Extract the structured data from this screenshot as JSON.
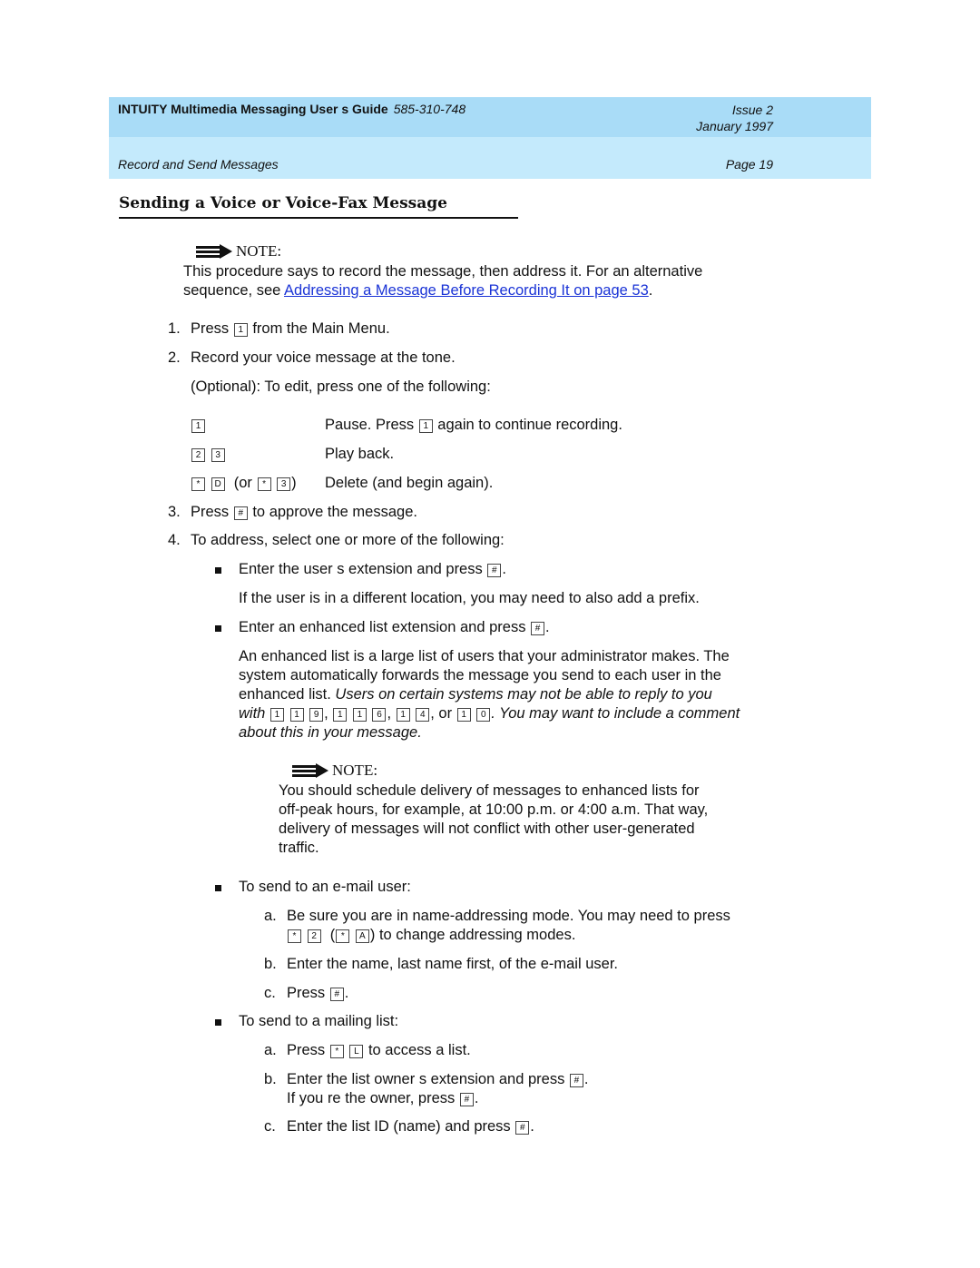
{
  "header": {
    "guide_title": "INTUITY Multimedia Messaging User s Guide",
    "doc_number": "585-310-748",
    "issue": "Issue 2",
    "date": "January 1997",
    "section": "Record and Send Messages",
    "page": "Page 19"
  },
  "colors": {
    "header_top": "#a9dcf7",
    "header_bottom": "#c4eafc",
    "link": "#1a33d6"
  },
  "title": "Sending a Voice or Voice-Fax Message",
  "note1": {
    "label": "NOTE:",
    "icon": "note-arrow-icon",
    "line1": "This procedure says to record the message, then address it. For an alternative",
    "line2_prefix": "sequence, see ",
    "link_text": " Addressing a Message Before Recording It   on page 53",
    "line2_suffix": "."
  },
  "steps": {
    "s1": {
      "num": "1.",
      "pre": "Press ",
      "key": "1",
      "post": " from the Main Menu."
    },
    "s2": {
      "num": "2.",
      "text": "Record your voice message at the tone."
    },
    "optional": "(Optional): To edit, press one of the following:",
    "edit_options": [
      {
        "keys": [
          "1"
        ],
        "desc_pre": "Pause. Press ",
        "desc_key": "1",
        "desc_post": " again to continue recording."
      },
      {
        "keys": [
          "2",
          "3"
        ],
        "desc": "Play back."
      },
      {
        "keys": [
          "*",
          "D"
        ],
        "alt_pre": "(or ",
        "alt_keys": [
          "*",
          "3"
        ],
        "alt_post": ")",
        "desc": "Delete (and begin again)."
      }
    ],
    "s3": {
      "num": "3.",
      "pre": "Press ",
      "key": "#",
      "post": " to approve the message."
    },
    "s4": {
      "num": "4.",
      "text": "To address, select one or more of the following:"
    }
  },
  "address_options": {
    "ext": {
      "pre": "Enter the user s extension and press ",
      "key": "#",
      "post": ".",
      "sub": "If the user is in a different location, you may need to also add a prefix."
    },
    "enhanced": {
      "pre": "Enter an enhanced list extension and press ",
      "key": "#",
      "post": ".",
      "p1": "An enhanced list is a large list of users that your administrator makes. The",
      "p2": "system automatically forwards the message you send to each user in the",
      "p3_plain": "enhanced list. ",
      "p3_italic": "Users on certain systems may not be able to reply to you",
      "p4_with": "with ",
      "p4_keys": [
        [
          "1",
          "1",
          "9"
        ],
        [
          "1",
          "1",
          "6"
        ],
        [
          "1",
          "4"
        ],
        [
          "1",
          "0"
        ]
      ],
      "p4_or": ", or ",
      "p4_comma": ", ",
      "p4_end": ". You may want to include a comment",
      "p5": "about this in your message."
    },
    "note2": {
      "label": "NOTE:",
      "lines": [
        "You should schedule delivery of  messages to enhanced lists for",
        "off-peak hours, for example, at 10:00 p.m. or 4:00 a.m. That way,",
        "delivery of messages will not conflict with other user-generated",
        "traffic."
      ]
    },
    "email": {
      "text": "To send to an e-mail user:",
      "a_letter": "a.",
      "a_line1": "Be sure you are in name-addressing mode. You may need to press",
      "a_keys1": [
        "*",
        "2"
      ],
      "a_open": "(",
      "a_keys2": [
        "*",
        "A"
      ],
      "a_close": ") to change addressing modes.",
      "b_letter": "b.",
      "b_text": "Enter the name, last name first, of the e-mail user.",
      "c_letter": "c.",
      "c_pre": "Press ",
      "c_key": "#",
      "c_post": "."
    },
    "mailing": {
      "text": "To send to a mailing list:",
      "a_letter": "a.",
      "a_pre": "Press ",
      "a_keys": [
        "*",
        "L"
      ],
      "a_post": " to access a list.",
      "b_letter": "b.",
      "b_pre": "Enter the list owner s extension and press ",
      "b_key": "#",
      "b_post": ".",
      "b2_pre": "If you re the owner, press ",
      "b2_key": "#",
      "b2_post": ".",
      "c_letter": "c.",
      "c_pre": "Enter the list ID (name) and press ",
      "c_key": "#",
      "c_post": "."
    }
  }
}
